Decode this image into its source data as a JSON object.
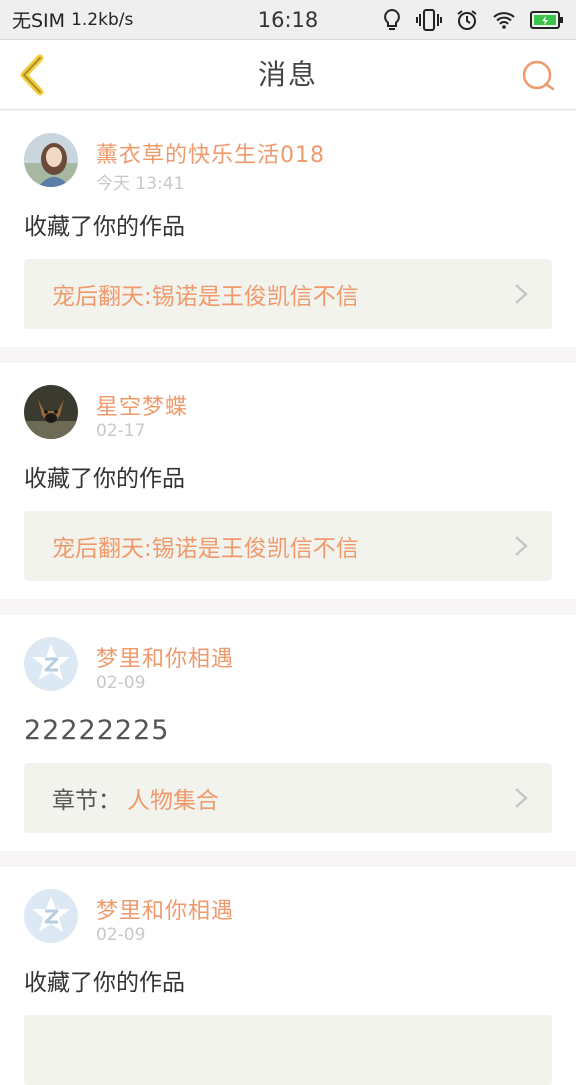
{
  "status_bar": {
    "carrier": "无SIM",
    "speed": "1.2kb/s",
    "time": "16:18",
    "icons": [
      "bulb-icon",
      "vibrate-icon",
      "alarm-icon",
      "wifi-icon",
      "battery-charging-icon"
    ]
  },
  "nav": {
    "title": "消息",
    "back_icon": "chevron-left-icon",
    "search_icon": "search-icon",
    "accent": "#f09a6c",
    "back_color": "#f2cc3c"
  },
  "messages": [
    {
      "user": "薰衣草的快乐生活018",
      "time": "今天 13:41",
      "text": "收藏了你的作品",
      "ref_label": "",
      "ref_title": "宠后翻天:锡诺是王俊凯信不信",
      "avatar": "photo-girl"
    },
    {
      "user": "星空梦蝶",
      "time": "02-17",
      "text": "收藏了你的作品",
      "ref_label": "",
      "ref_title": "宠后翻天:锡诺是王俊凯信不信",
      "avatar": "photo-dog"
    },
    {
      "user": "梦里和你相遇",
      "time": "02-09",
      "text": "22222225",
      "ref_label": "章节：",
      "ref_title": "人物集合",
      "avatar": "default-z-avatar"
    },
    {
      "user": "梦里和你相遇",
      "time": "02-09",
      "text": "收藏了你的作品",
      "ref_label": "",
      "ref_title": "",
      "avatar": "default-z-avatar"
    }
  ]
}
